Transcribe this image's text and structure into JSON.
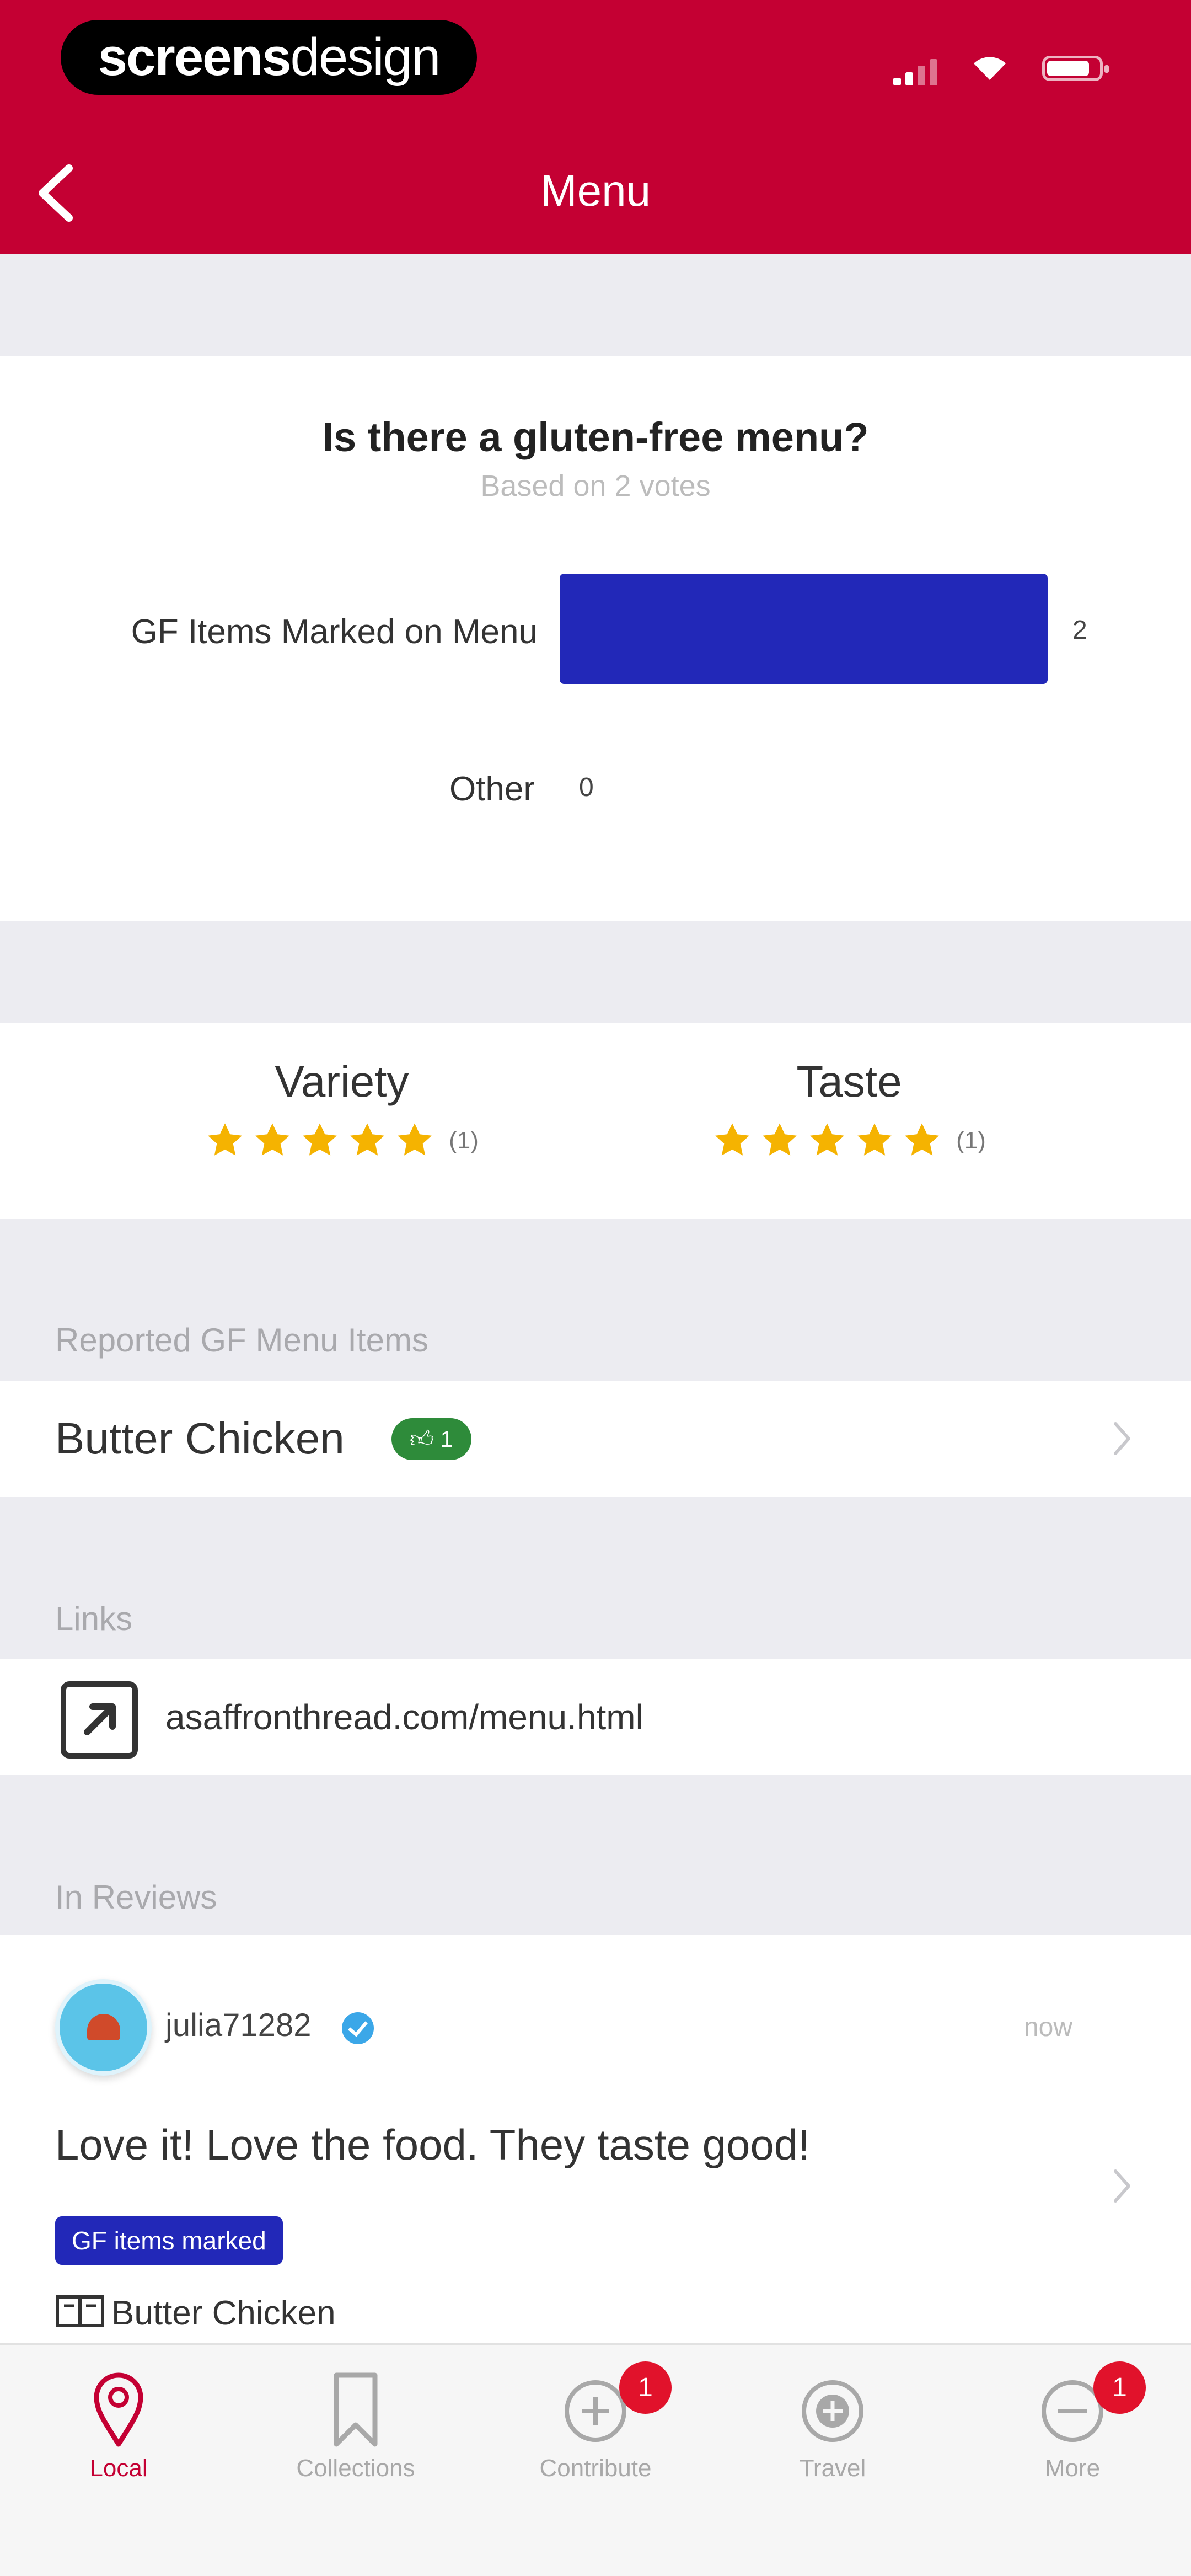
{
  "brand": {
    "part1": "screens",
    "part2": "design"
  },
  "nav": {
    "title": "Menu"
  },
  "poll": {
    "title": "Is there a gluten-free menu?",
    "subtitle": "Based on 2 votes",
    "options": [
      {
        "label": "GF Items Marked on Menu",
        "count": "2",
        "value": 2
      },
      {
        "label": "Other",
        "count": "0",
        "value": 0
      }
    ]
  },
  "ratings": [
    {
      "label": "Variety",
      "stars": 5,
      "count": "(1)"
    },
    {
      "label": "Taste",
      "stars": 5,
      "count": "(1)"
    }
  ],
  "reported": {
    "section_label": "Reported GF Menu Items",
    "items": [
      {
        "name": "Butter Chicken",
        "votes": "1"
      }
    ]
  },
  "links": {
    "section_label": "Links",
    "items": [
      {
        "url": "asaffronthread.com/menu.html"
      }
    ]
  },
  "reviews": {
    "section_label": "In Reviews",
    "items": [
      {
        "username": "julia71282",
        "time": "now",
        "text": "Love it! Love the food. They taste good!",
        "tag": "GF items marked",
        "menu_item": "Butter Chicken"
      }
    ]
  },
  "tabbar": {
    "tabs": [
      {
        "label": "Local",
        "icon": "location-pin-icon",
        "active": true
      },
      {
        "label": "Collections",
        "icon": "bookmark-icon"
      },
      {
        "label": "Contribute",
        "icon": "plus-circle-icon",
        "badge": "1"
      },
      {
        "label": "Travel",
        "icon": "travel-icon"
      },
      {
        "label": "More",
        "icon": "more-icon",
        "badge": "1"
      }
    ]
  },
  "colors": {
    "header": "#C40033",
    "poll_bar": "#2228B8",
    "vote_badge": "#2E8B3A",
    "star": "#F5B301",
    "tab_active": "#C40033",
    "badge": "#E1122B"
  }
}
